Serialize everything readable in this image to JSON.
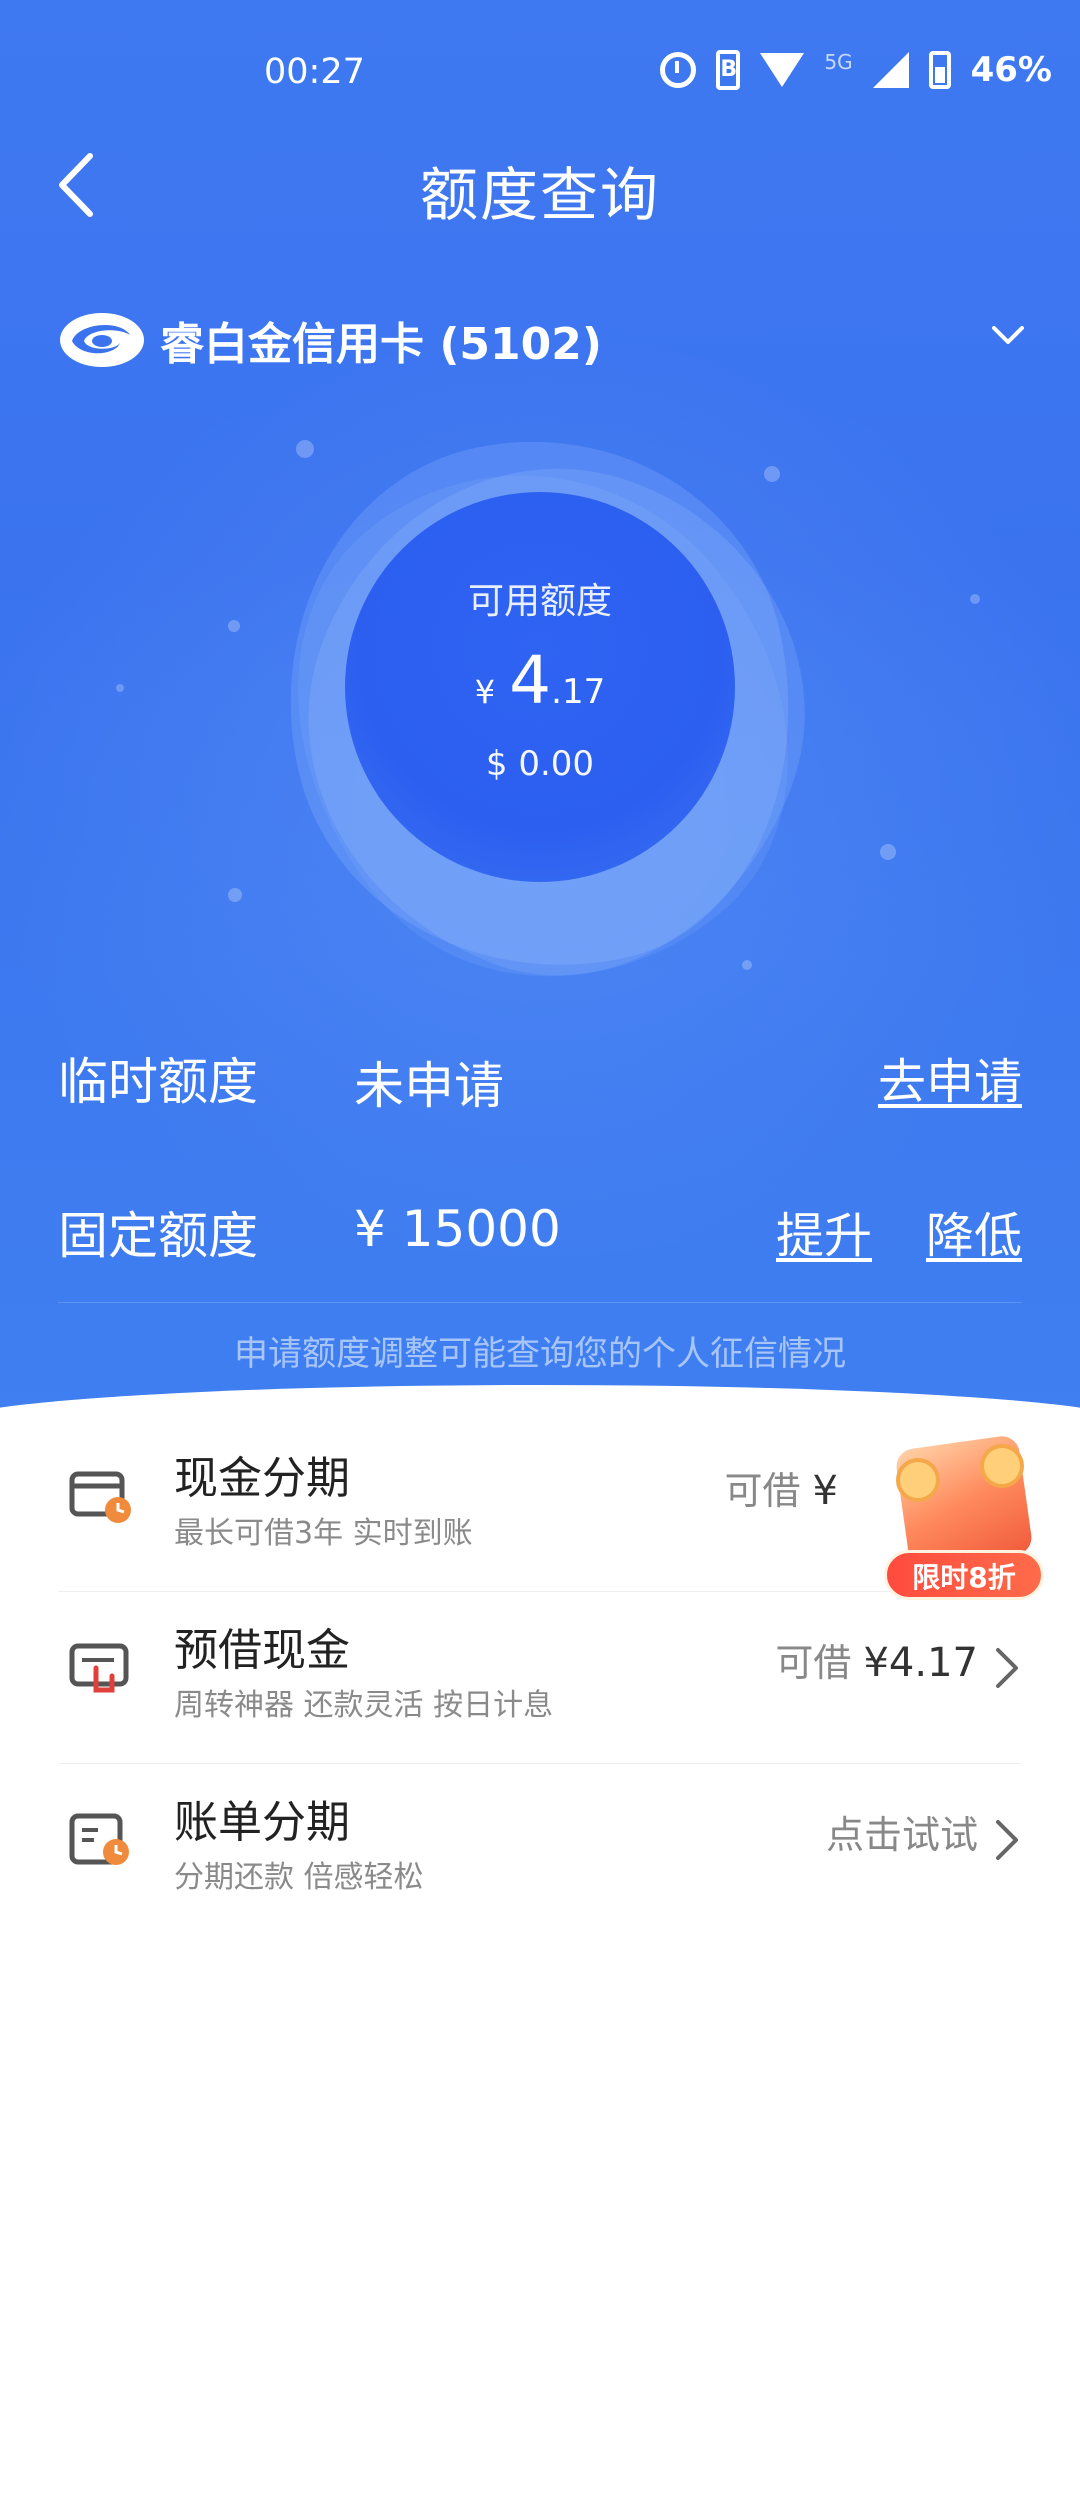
{
  "status_bar": {
    "time": "00:27",
    "network": "5G",
    "battery": "46%"
  },
  "header": {
    "title": "额度查询"
  },
  "card": {
    "name": "睿白金信用卡 (5102)"
  },
  "available": {
    "label": "可用额度",
    "currency_symbol": "¥",
    "integer": "4",
    "decimal": ".17",
    "usd": "$ 0.00"
  },
  "temp_limit": {
    "label": "临时额度",
    "value": "未申请",
    "action": "去申请"
  },
  "fixed_limit": {
    "label": "固定额度",
    "value": "¥ 15000",
    "raise": "提升",
    "lower": "降低"
  },
  "hint": "申请额度调整可能查询您的个人征信情况",
  "list": [
    {
      "title": "现金分期",
      "subtitle": "最长可借3年 实时到账",
      "action_prefix": "可借",
      "action_amount": "¥"
    },
    {
      "title": "预借现金",
      "subtitle": "周转神器 还款灵活 按日计息",
      "action_prefix": "可借",
      "action_amount": "¥4.17"
    },
    {
      "title": "账单分期",
      "subtitle": "分期还款 倍感轻松",
      "action_prefix": "点击试试",
      "action_amount": ""
    }
  ],
  "promo": {
    "label": "限时8折"
  },
  "colors": {
    "primary_blue": "#3b73ef",
    "icon_orange": "#f08a3c",
    "icon_red": "#e0403a"
  }
}
